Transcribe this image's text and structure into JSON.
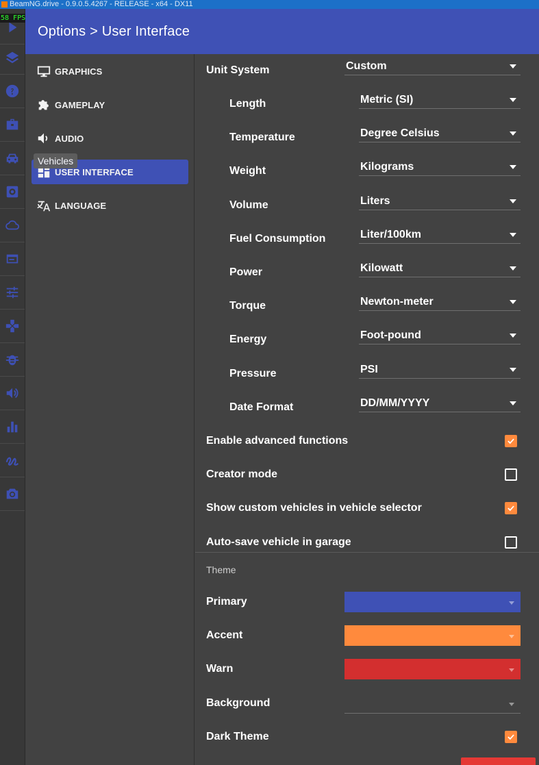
{
  "window": {
    "title": "BeamNG.drive - 0.9.0.5.4267 - RELEASE - x64 - DX11",
    "fps": "58 FPS"
  },
  "header": {
    "title": "Options > User Interface"
  },
  "tooltip": "Vehicles",
  "sidebar": {
    "items": [
      {
        "label": "GRAPHICS",
        "icon": "monitor-icon",
        "active": false
      },
      {
        "label": "GAMEPLAY",
        "icon": "puzzle-icon",
        "active": false
      },
      {
        "label": "AUDIO",
        "icon": "speaker-icon",
        "active": false
      },
      {
        "label": "USER INTERFACE",
        "icon": "dashboard-icon",
        "active": true
      },
      {
        "label": "LANGUAGE",
        "icon": "translate-icon",
        "active": false
      }
    ]
  },
  "rail": {
    "icons": [
      "play-icon",
      "layers-icon",
      "help-icon",
      "briefcase-icon",
      "car-icon",
      "chip-icon",
      "cloud-icon",
      "calendar-icon",
      "sliders-icon",
      "gamepad-icon",
      "bug-icon",
      "volume-icon",
      "bar-chart-icon",
      "route-icon",
      "camera-icon"
    ]
  },
  "units": {
    "unit_system": {
      "label": "Unit System",
      "value": "Custom"
    },
    "fields": [
      {
        "label": "Length",
        "value": "Metric (SI)"
      },
      {
        "label": "Temperature",
        "value": "Degree Celsius"
      },
      {
        "label": "Weight",
        "value": "Kilograms"
      },
      {
        "label": "Volume",
        "value": "Liters"
      },
      {
        "label": "Fuel Consumption",
        "value": "Liter/100km"
      },
      {
        "label": "Power",
        "value": "Kilowatt"
      },
      {
        "label": "Torque",
        "value": "Newton-meter"
      },
      {
        "label": "Energy",
        "value": "Foot-pound"
      },
      {
        "label": "Pressure",
        "value": "PSI"
      },
      {
        "label": "Date Format",
        "value": "DD/MM/YYYY"
      }
    ]
  },
  "toggles": [
    {
      "label": "Enable advanced functions",
      "checked": true
    },
    {
      "label": "Creator mode",
      "checked": false
    },
    {
      "label": "Show custom vehicles in vehicle selector",
      "checked": true
    },
    {
      "label": "Auto-save vehicle in garage",
      "checked": false
    }
  ],
  "theme": {
    "title": "Theme",
    "colors": [
      {
        "label": "Primary",
        "color": "#3f51b5"
      },
      {
        "label": "Accent",
        "color": "#ff8a3d"
      },
      {
        "label": "Warn",
        "color": "#d32f2f"
      },
      {
        "label": "Background",
        "color": ""
      }
    ],
    "dark_theme": {
      "label": "Dark Theme",
      "checked": true
    }
  }
}
